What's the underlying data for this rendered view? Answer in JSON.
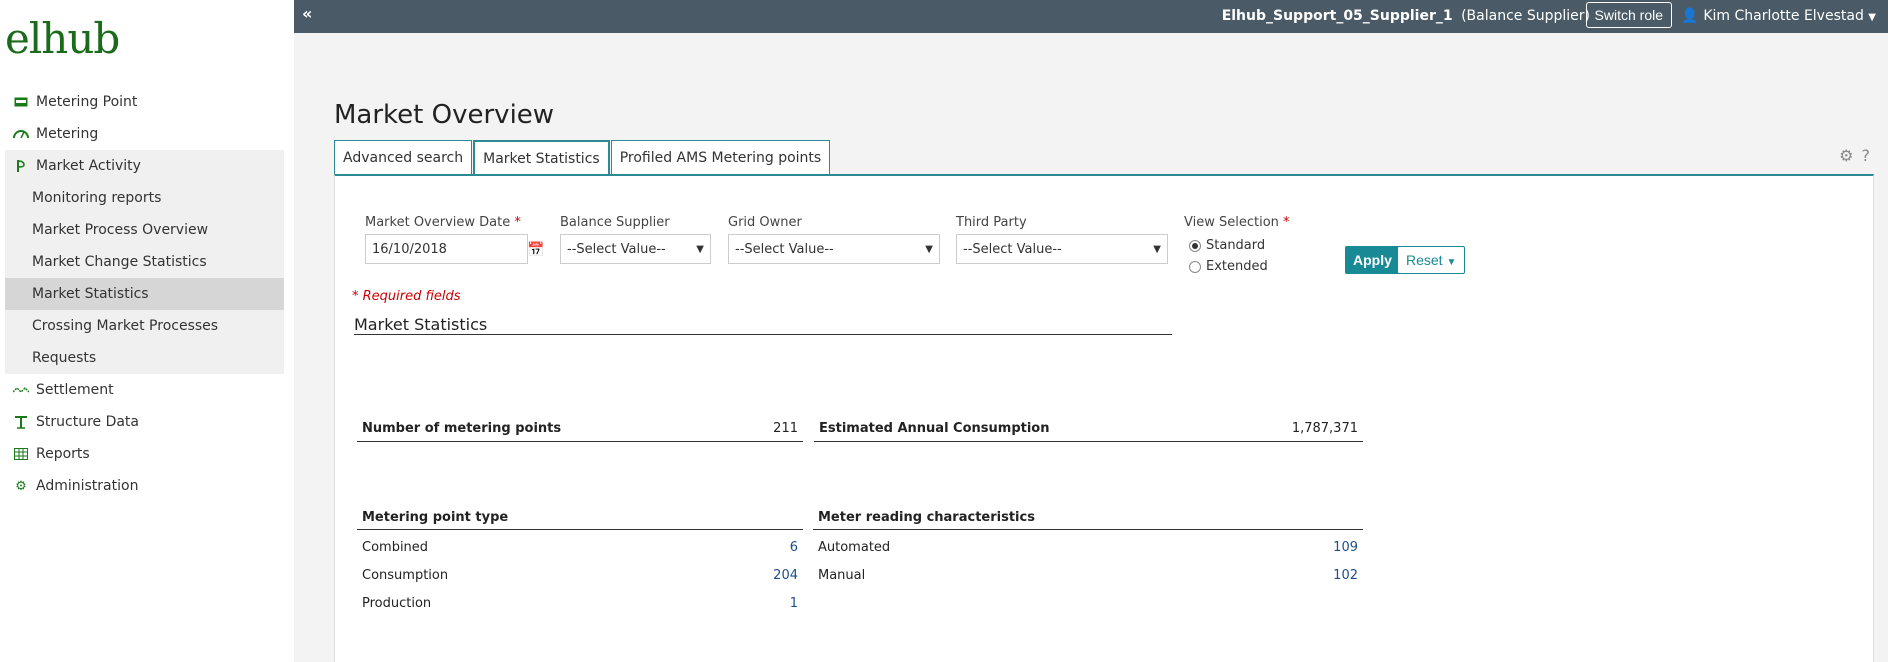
{
  "app": {
    "logo": "elhub"
  },
  "sidebar": {
    "items": [
      {
        "label": "Metering Point",
        "icon": "meter-box-icon"
      },
      {
        "label": "Metering",
        "icon": "gauge-icon"
      },
      {
        "label": "Market Activity",
        "icon": "market-activity-icon"
      }
    ],
    "market_activity_sub": [
      "Monitoring reports",
      "Market Process Overview",
      "Market Change Statistics",
      "Market Statistics",
      "Crossing Market Processes",
      "Requests"
    ],
    "items_after": [
      {
        "label": "Settlement",
        "icon": "settlement-icon"
      },
      {
        "label": "Structure Data",
        "icon": "structure-icon"
      },
      {
        "label": "Reports",
        "icon": "table-icon"
      },
      {
        "label": "Administration",
        "icon": "gear-icon"
      }
    ]
  },
  "topbar": {
    "user_org": "Elhub_Support_05_Supplier_1",
    "role": "(Balance Supplier)",
    "switch_role": "Switch role",
    "user_name": "Kim Charlotte Elvestad"
  },
  "page": {
    "title": "Market Overview",
    "tabs": [
      "Advanced search",
      "Market Statistics",
      "Profiled AMS Metering points"
    ]
  },
  "filters": {
    "date_label": "Market Overview Date",
    "date_value": "16/10/2018",
    "balance_supplier_label": "Balance Supplier",
    "grid_owner_label": "Grid Owner",
    "third_party_label": "Third Party",
    "select_placeholder": "--Select Value--",
    "view_selection_label": "View Selection",
    "view_options": [
      "Standard",
      "Extended"
    ],
    "apply": "Apply",
    "reset": "Reset",
    "required_note": "* Required fields",
    "req_marker": "*"
  },
  "stats": {
    "section_title": "Market Statistics",
    "num_metering_points_label": "Number of metering points",
    "num_metering_points": "211",
    "annual_consumption_label": "Estimated Annual Consumption",
    "annual_consumption": "1,787,371",
    "mp_type_header": "Metering point type",
    "mp_types": [
      {
        "label": "Combined",
        "value": "6"
      },
      {
        "label": "Consumption",
        "value": "204"
      },
      {
        "label": "Production",
        "value": "1"
      }
    ],
    "reading_header": "Meter reading characteristics",
    "readings": [
      {
        "label": "Automated",
        "value": "109"
      },
      {
        "label": "Manual",
        "value": "102"
      }
    ]
  }
}
